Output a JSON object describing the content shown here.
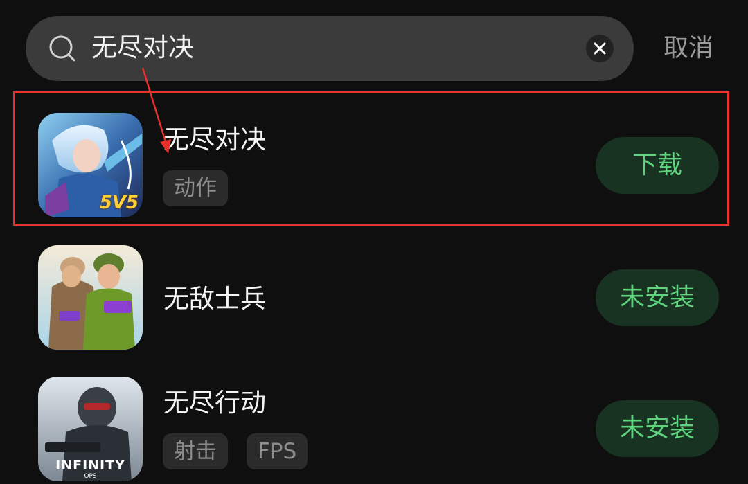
{
  "search": {
    "query": "无尽对决",
    "cancel_label": "取消"
  },
  "results": [
    {
      "name": "无尽对决",
      "tags": [
        "动作"
      ],
      "action": "下载",
      "icon": "mobile-legends-game-icon"
    },
    {
      "name": "无敌士兵",
      "tags": [],
      "action": "未安装",
      "icon": "soldiers-game-icon"
    },
    {
      "name": "无尽行动",
      "tags": [
        "射击",
        "FPS"
      ],
      "action": "未安装",
      "icon": "infinity-ops-game-icon",
      "icon_caption": "INFINITY",
      "icon_subcaption": "OPS"
    }
  ],
  "icon_badge_1": "5V5",
  "colors": {
    "background": "#0f0f0f",
    "search_bar": "#3b3b3b",
    "action_text": "#5fd27d",
    "action_bg": "#183322",
    "highlight": "#e8302d"
  }
}
